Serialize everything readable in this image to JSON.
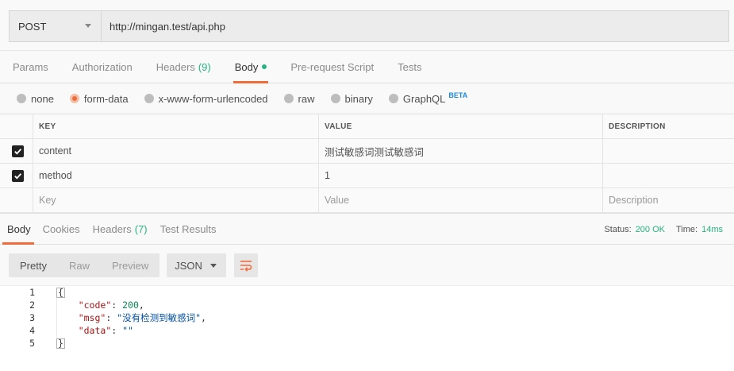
{
  "request": {
    "method": "POST",
    "url": "http://mingan.test/api.php"
  },
  "request_tabs": [
    {
      "label": "Params"
    },
    {
      "label": "Authorization"
    },
    {
      "label": "Headers",
      "count": "(9)"
    },
    {
      "label": "Body",
      "active": true
    },
    {
      "label": "Pre-request Script"
    },
    {
      "label": "Tests"
    }
  ],
  "body_types": [
    {
      "label": "none"
    },
    {
      "label": "form-data",
      "selected": true
    },
    {
      "label": "x-www-form-urlencoded"
    },
    {
      "label": "raw"
    },
    {
      "label": "binary"
    },
    {
      "label": "GraphQL",
      "badge": "BETA"
    }
  ],
  "params_table": {
    "headers": {
      "key": "KEY",
      "value": "VALUE",
      "description": "DESCRIPTION"
    },
    "rows": [
      {
        "checked": true,
        "key": "content",
        "value": "测试敏感词测试敏感词",
        "description": ""
      },
      {
        "checked": true,
        "key": "method",
        "value": "1",
        "description": ""
      }
    ],
    "placeholder": {
      "key": "Key",
      "value": "Value",
      "description": "Description"
    }
  },
  "response_tabs": [
    {
      "label": "Body",
      "active": true
    },
    {
      "label": "Cookies"
    },
    {
      "label": "Headers",
      "count": "(7)"
    },
    {
      "label": "Test Results"
    }
  ],
  "response_status": {
    "status_label": "Status:",
    "status_value": "200 OK",
    "time_label": "Time:",
    "time_value": "14ms"
  },
  "response_toolbar": {
    "views": [
      "Pretty",
      "Raw",
      "Preview"
    ],
    "format": "JSON"
  },
  "response_body": {
    "line_numbers": [
      "1",
      "2",
      "3",
      "4",
      "5"
    ],
    "open_brace": "{",
    "close_brace": "}",
    "fields": [
      {
        "key": "\"code\"",
        "value": "200",
        "type": "number"
      },
      {
        "key": "\"msg\"",
        "value": "\"没有检测到敏感词\"",
        "type": "string"
      },
      {
        "key": "\"data\"",
        "value": "\"\"",
        "type": "string"
      }
    ]
  },
  "colors": {
    "accent": "#f26b3a",
    "success": "#26b47f",
    "beta": "#1e8ad6"
  }
}
